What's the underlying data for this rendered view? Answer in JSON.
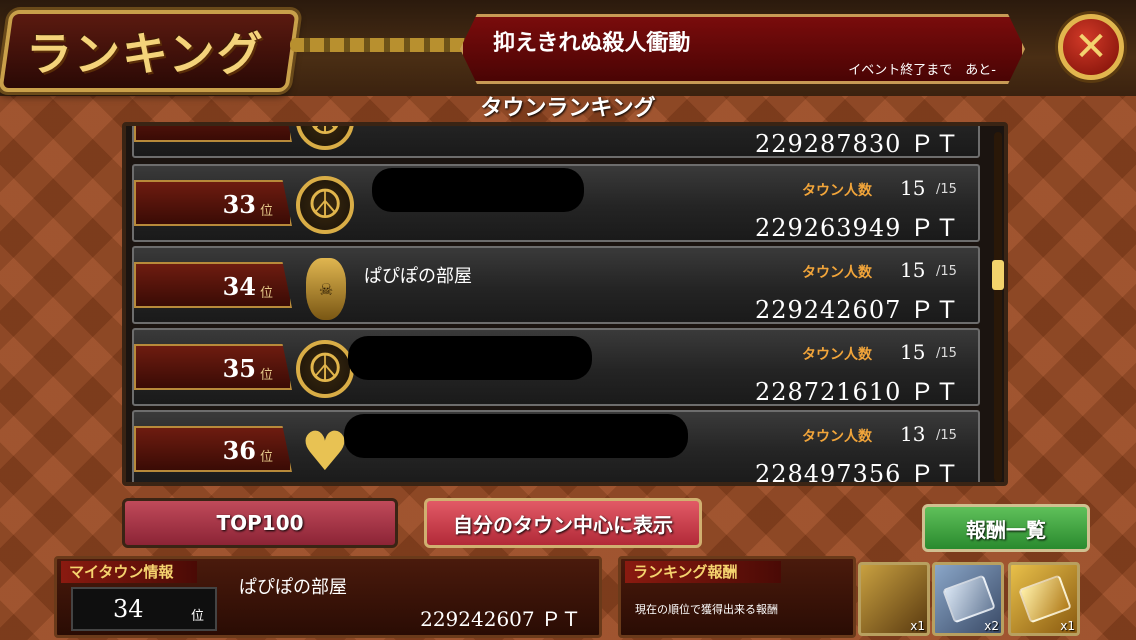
{
  "header": {
    "title": "ランキング",
    "event_title": "抑えきれぬ殺人衝動",
    "event_sub": "イベント終了まで　あと-",
    "close_symbol": "✕"
  },
  "section_title": "タウンランキング",
  "partial_row_points": "229287830 ＰＴ",
  "rows": [
    {
      "rank": "33",
      "rank_unit": "位",
      "emblem": "peace-icon",
      "emblem_glyph": "☮",
      "name": "",
      "count_label": "タウン人数",
      "count": "15",
      "count_max": "/15",
      "points": "229263949 ＰＴ"
    },
    {
      "rank": "34",
      "rank_unit": "位",
      "emblem": "mask-icon",
      "emblem_glyph": "☠",
      "name": "ぱぴぽの部屋",
      "count_label": "タウン人数",
      "count": "15",
      "count_max": "/15",
      "points": "229242607 ＰＴ"
    },
    {
      "rank": "35",
      "rank_unit": "位",
      "emblem": "peace-icon",
      "emblem_glyph": "☮",
      "name": "",
      "count_label": "タウン人数",
      "count": "15",
      "count_max": "/15",
      "points": "228721610 ＰＴ"
    },
    {
      "rank": "36",
      "rank_unit": "位",
      "emblem": "heart-icon",
      "emblem_glyph": "♥",
      "name": "",
      "count_label": "タウン人数",
      "count": "13",
      "count_max": "/15",
      "points": "228497356 ＰＴ"
    }
  ],
  "buttons": {
    "top100": "TOP100",
    "center": "自分のタウン中心に表示",
    "reward_list": "報酬一覧"
  },
  "my_town": {
    "header": "マイタウン情報",
    "rank": "34",
    "rank_unit": "位",
    "name": "ぱぴぽの部屋",
    "points": "229242607 ＰＴ"
  },
  "reward": {
    "header": "ランキング報酬",
    "desc": "現在の順位で獲得出来る報酬",
    "items": [
      {
        "icon": "character-portrait-icon",
        "qty": "x1"
      },
      {
        "icon": "silver-ticket-icon",
        "qty": "x2"
      },
      {
        "icon": "gold-ticket-icon",
        "qty": "x1"
      }
    ]
  },
  "colors": {
    "background": "#9a4a22",
    "accent_gold": "#e2b64c",
    "count_label": "#f2a53a",
    "button_red": "#b22a38",
    "button_green": "#2a8a2e"
  }
}
